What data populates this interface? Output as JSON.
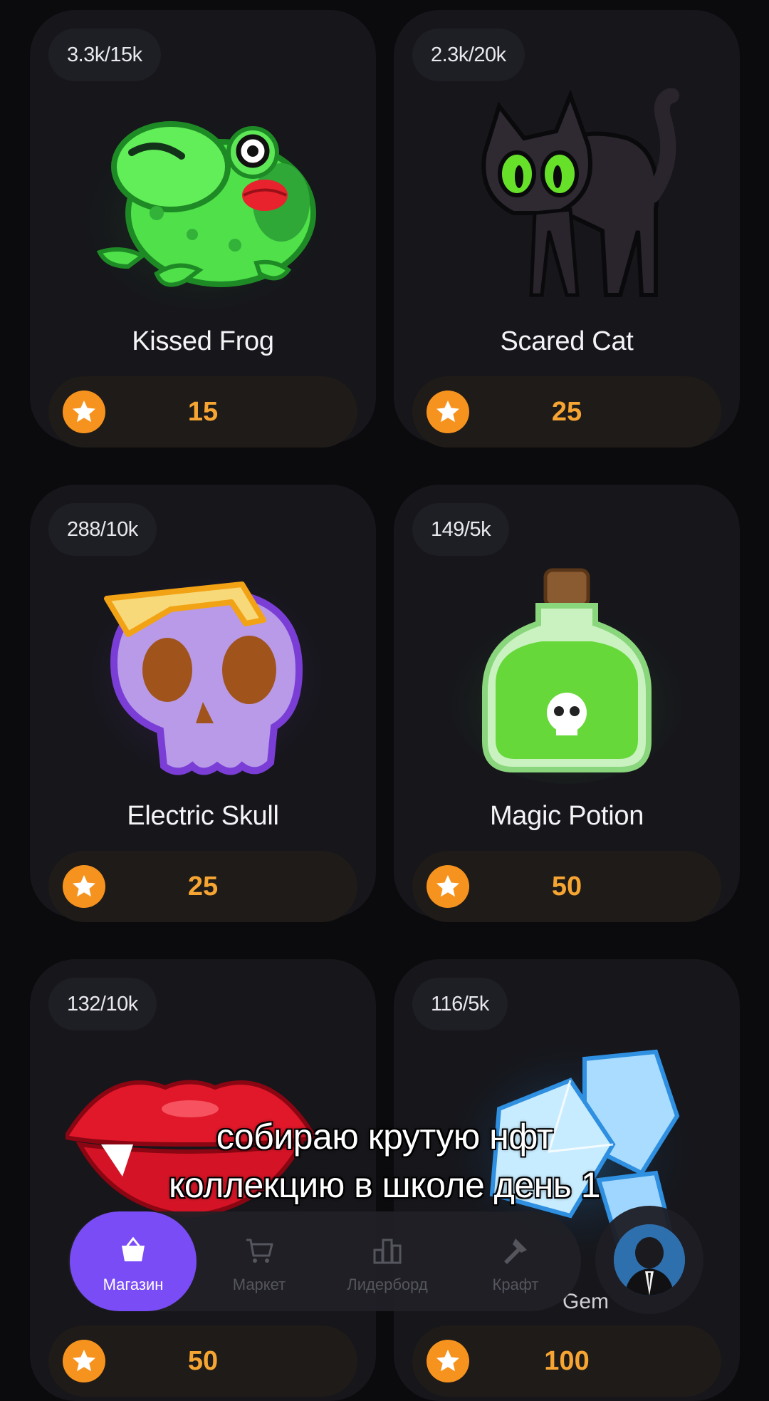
{
  "items": [
    {
      "count": "3.3k/15k",
      "title": "Kissed Frog",
      "price": "15"
    },
    {
      "count": "2.3k/20k",
      "title": "Scared Cat",
      "price": "25"
    },
    {
      "count": "288/10k",
      "title": "Electric Skull",
      "price": "25"
    },
    {
      "count": "149/5k",
      "title": "Magic Potion",
      "price": "50"
    },
    {
      "count": "132/10k",
      "title": "",
      "price": "50"
    },
    {
      "count": "116/5k",
      "title": "",
      "price": "100"
    }
  ],
  "peek_text": "Gem",
  "caption": {
    "line1": "собираю крутую нфт",
    "line2": "коллекцию в школе день 1"
  },
  "nav": {
    "tabs": [
      {
        "label": "Магазин",
        "icon": "basket-icon",
        "active": true
      },
      {
        "label": "Маркет",
        "icon": "cart-icon",
        "active": false
      },
      {
        "label": "Лидерборд",
        "icon": "leaderboard-icon",
        "active": false
      },
      {
        "label": "Крафт",
        "icon": "hammer-icon",
        "active": false
      }
    ]
  },
  "colors": {
    "accent": "#7a4cf5",
    "star": "#f6931e",
    "price_text": "#f6a533",
    "background": "#0b0b0e",
    "card": "#16161b"
  }
}
